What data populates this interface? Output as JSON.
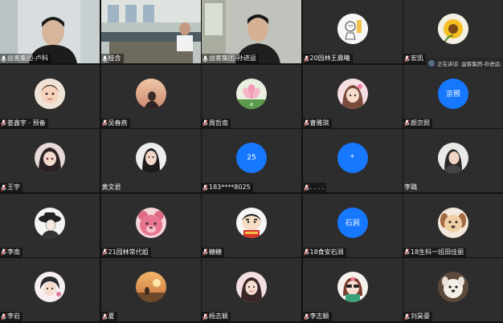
{
  "speaking_indicator": "正在讲话: 益客集团-孙进运; 韩...",
  "tiles": [
    {
      "name": "益客集团-卢科",
      "kind": "video",
      "mic": "on"
    },
    {
      "name": "桂含",
      "kind": "video",
      "mic": "on"
    },
    {
      "name": "益客集团-孙进运",
      "kind": "video",
      "mic": "on"
    },
    {
      "name": "20园林王晨曦",
      "kind": "avatar",
      "avatar_icon": "cartoon-drawing-avatar",
      "mic": "muted"
    },
    {
      "name": "宏凯",
      "kind": "avatar",
      "avatar_icon": "sunflower-avatar",
      "mic": "muted"
    },
    {
      "name": "娄鑫宇 · 预备",
      "kind": "avatar",
      "avatar_icon": "baby-photo-avatar",
      "mic": "muted"
    },
    {
      "name": "吴春燕",
      "kind": "avatar",
      "avatar_icon": "sunset-silhouette-avatar",
      "mic": "muted"
    },
    {
      "name": "周哲南",
      "kind": "avatar",
      "avatar_icon": "lotus-flower-avatar",
      "mic": "muted"
    },
    {
      "name": "曹雅琪",
      "kind": "avatar",
      "avatar_icon": "anime-girl-avatar",
      "mic": "muted"
    },
    {
      "name": "颜京照",
      "kind": "avatar-text",
      "avatar_text": "京照",
      "mic": "muted"
    },
    {
      "name": "王宇",
      "kind": "avatar",
      "avatar_icon": "anime-girl-dark-hair-avatar",
      "mic": "muted"
    },
    {
      "name": "黄文君",
      "kind": "avatar",
      "avatar_icon": "girl-portrait-avatar",
      "mic": "none"
    },
    {
      "name": "183****8025",
      "kind": "avatar-text",
      "avatar_text": "25",
      "mic": "muted"
    },
    {
      "name": ". . . .",
      "kind": "avatar-text",
      "avatar_text": "*",
      "mic": "muted"
    },
    {
      "name": "李璐",
      "kind": "avatar",
      "avatar_icon": "woman-portrait-avatar",
      "mic": "none"
    },
    {
      "name": "李南",
      "kind": "avatar",
      "avatar_icon": "hat-girl-sketch-avatar",
      "mic": "muted"
    },
    {
      "name": "21园林常代姐",
      "kind": "avatar",
      "avatar_icon": "lotso-bear-avatar",
      "mic": "muted"
    },
    {
      "name": "糖糖",
      "kind": "avatar",
      "avatar_icon": "crayon-shinchan-avatar",
      "mic": "muted"
    },
    {
      "name": "18食安石涧",
      "kind": "avatar-text",
      "avatar_text": "石涧",
      "mic": "muted"
    },
    {
      "name": "18生科一班田佳丽",
      "kind": "avatar",
      "avatar_icon": "dog-cartoon-avatar",
      "mic": "muted"
    },
    {
      "name": "李岩",
      "kind": "avatar",
      "avatar_icon": "anime-boy-avatar",
      "mic": "muted"
    },
    {
      "name": "夏",
      "kind": "avatar",
      "avatar_icon": "sunset-field-avatar",
      "mic": "muted"
    },
    {
      "name": "杨志颖",
      "kind": "avatar",
      "avatar_icon": "girl-selfie-avatar",
      "mic": "muted"
    },
    {
      "name": "李志颖",
      "kind": "avatar",
      "avatar_icon": "cartoon-sunglasses-girl-avatar",
      "mic": "muted"
    },
    {
      "name": "刘昊豪",
      "kind": "avatar",
      "avatar_icon": "puppy-avatar",
      "mic": "muted"
    }
  ]
}
